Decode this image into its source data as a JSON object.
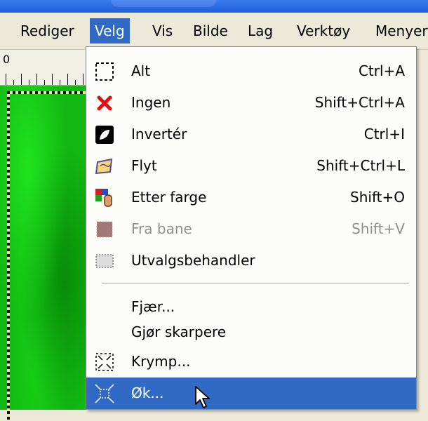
{
  "menubar": {
    "items": [
      {
        "label": "Rediger"
      },
      {
        "label": "Velg"
      },
      {
        "label": "Vis"
      },
      {
        "label": "Bilde"
      },
      {
        "label": "Lag"
      },
      {
        "label": "Verktøy"
      },
      {
        "label": "Menyer"
      }
    ],
    "active_index": 1
  },
  "ruler": {
    "start_label": "0"
  },
  "select_menu": {
    "items": [
      {
        "label": "Alt",
        "shortcut": "Ctrl+A",
        "icon": "select-all-icon"
      },
      {
        "label": "Ingen",
        "shortcut": "Shift+Ctrl+A",
        "icon": "select-none-icon"
      },
      {
        "label": "Invertér",
        "shortcut": "Ctrl+I",
        "icon": "invert-selection-icon"
      },
      {
        "label": "Flyt",
        "shortcut": "Shift+Ctrl+L",
        "icon": "float-selection-icon"
      },
      {
        "label": "Etter farge",
        "shortcut": "Shift+O",
        "icon": "by-color-select-icon"
      },
      {
        "label": "Fra bane",
        "shortcut": "Shift+V",
        "icon": "from-path-icon",
        "disabled": true
      },
      {
        "label": "Utvalgsbehandler",
        "shortcut": "",
        "icon": "selection-editor-icon"
      },
      {
        "label": "Fjær...",
        "shortcut": "",
        "icon": ""
      },
      {
        "label": "Gjør skarpere",
        "shortcut": "",
        "icon": ""
      },
      {
        "label": "Krymp...",
        "shortcut": "",
        "icon": "shrink-selection-icon"
      },
      {
        "label": "Øk...",
        "shortcut": "",
        "icon": "grow-selection-icon",
        "highlighted": true
      }
    ]
  },
  "colors": {
    "highlight": "#316ac5",
    "menu_background": "#fcfcf8",
    "canvas_green": "#12b812",
    "titlebar_blue": "#1f5ed8"
  }
}
